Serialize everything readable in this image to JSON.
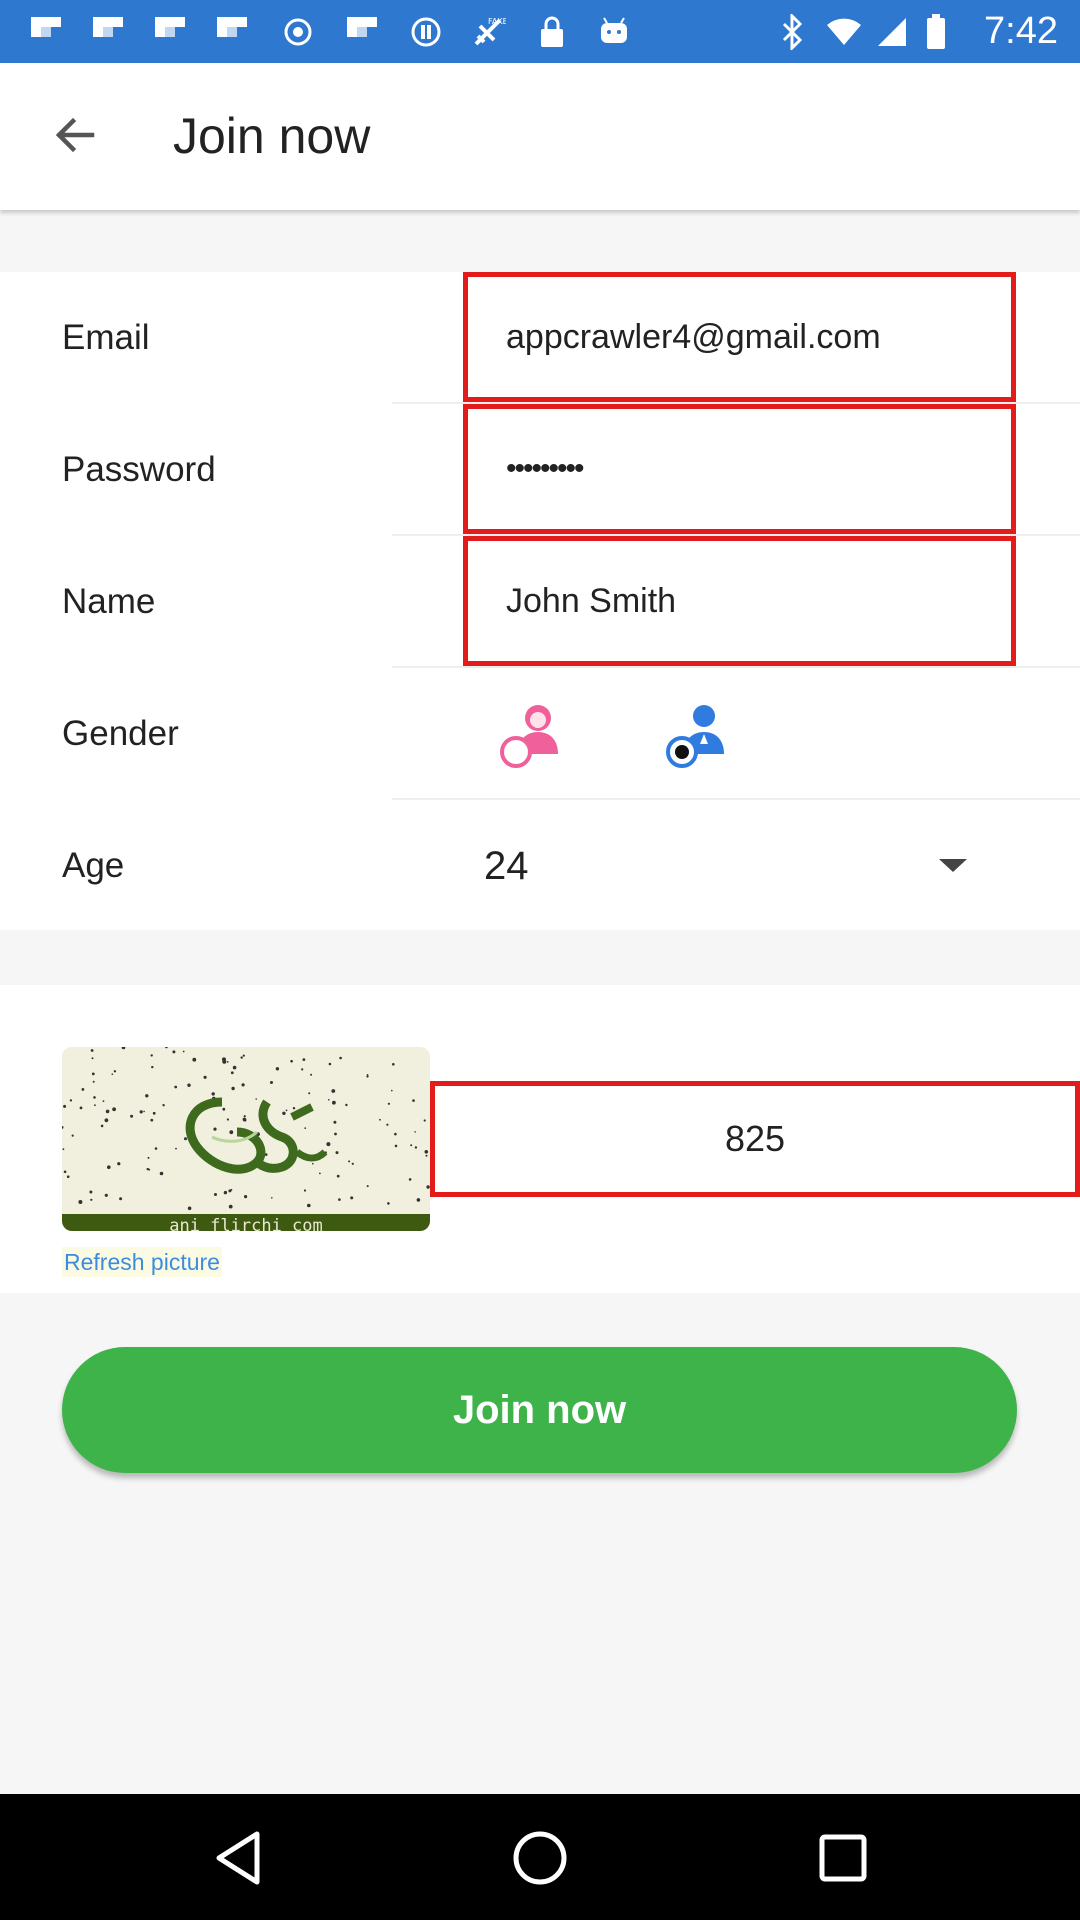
{
  "status_bar": {
    "time": "7:42",
    "icons": [
      "flipboard-icon",
      "flipboard-icon",
      "flipboard-icon",
      "flipboard-icon",
      "record-icon",
      "flipboard-icon",
      "settings-circle-icon",
      "fake-gps-icon",
      "lock-icon",
      "android-icon",
      "bluetooth-icon",
      "wifi-icon",
      "signal-icon",
      "battery-icon"
    ]
  },
  "app_bar": {
    "title": "Join now",
    "back_icon": "arrow-back-icon"
  },
  "form": {
    "email": {
      "label": "Email",
      "value": "appcrawler4@gmail.com"
    },
    "password": {
      "label": "Password",
      "value": "•••••••••"
    },
    "name": {
      "label": "Name",
      "value": "John Smith"
    },
    "gender": {
      "label": "Gender",
      "options": [
        "female-icon",
        "male-icon"
      ],
      "selected": "male"
    },
    "age": {
      "label": "Age",
      "value": "24"
    }
  },
  "captcha": {
    "code": "825",
    "refresh_label": "Refresh picture",
    "image_caption": "ani flirchi com"
  },
  "join_button": {
    "label": "Join now"
  },
  "colors": {
    "status_bar": "#2f78cf",
    "field_border": "#e31b1b",
    "join_button": "#3db34a",
    "link": "#3d8ce0",
    "female": "#f0609a",
    "male": "#2f7be0"
  },
  "nav_bar": {
    "icons": [
      "back-triangle-icon",
      "home-circle-icon",
      "recents-square-icon"
    ]
  }
}
